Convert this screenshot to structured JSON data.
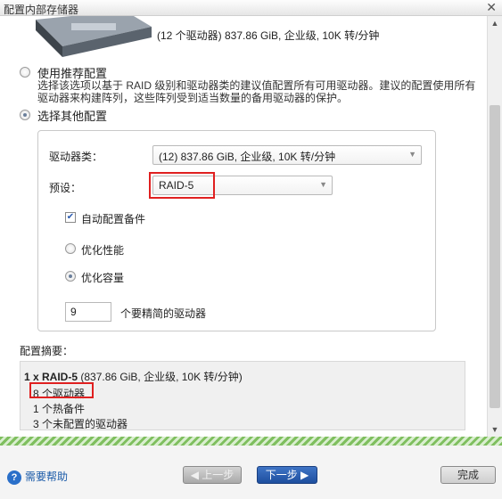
{
  "window": {
    "title": "配置内部存储器"
  },
  "drive": {
    "summary": "(12 个驱动器) 837.86 GiB, 企业级, 10K 转/分钟"
  },
  "options": {
    "recommended": {
      "label": "使用推荐配置",
      "description": "选择该选项以基于 RAID 级别和驱动器类的建议值配置所有可用驱动器。建议的配置使用所有驱动器来构建阵列，这些阵列受到适当数量的备用驱动器的保护。"
    },
    "other": {
      "label": "选择其他配置"
    }
  },
  "form": {
    "drive_class_label": "驱动器类：",
    "drive_class_value": "(12) 837.86 GiB, 企业级, 10K 转/分钟",
    "preset_label": "预设：",
    "preset_value": "RAID-5",
    "auto_spare_label": "自动配置备件",
    "optimize_performance_label": "优化性能",
    "optimize_capacity_label": "优化容量",
    "drive_count_value": "9",
    "drive_count_label": "个要精简的驱动器"
  },
  "summary": {
    "label": "配置摘要：",
    "line1_bold": "1 x RAID-5",
    "line1_rest": " (837.86 GiB, 企业级, 10K 转/分钟)",
    "drives": "8 个驱动器",
    "hot_spares": "1 个热备件",
    "unconfigured": "3 个未配置的驱动器"
  },
  "footer": {
    "help_label": "需要帮助",
    "prev_label": "◀ 上一步",
    "next_label": "下一步 ▶",
    "done_label": "完成"
  },
  "colors": {
    "highlight": "#e02020",
    "accent": "#1e4f9f"
  }
}
